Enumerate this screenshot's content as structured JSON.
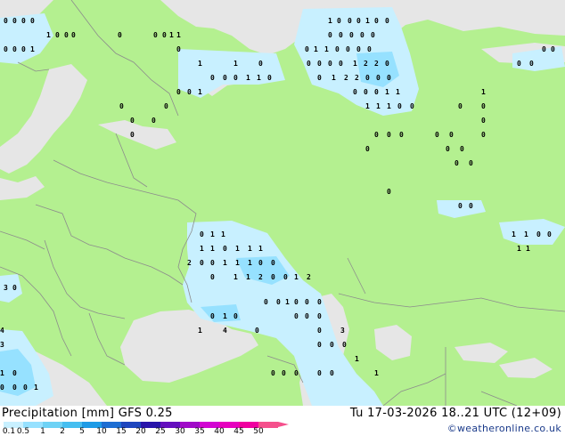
{
  "footer": {
    "title_left": "Precipitation [mm]  GFS 0.25",
    "title_right": "Tu 17-03-2026 18..21 UTC (12+09)",
    "copyright": "©weatheronline.co.uk"
  },
  "legend": {
    "ticks": [
      "0.1",
      "0.5",
      "1",
      "2",
      "5",
      "10",
      "15",
      "20",
      "25",
      "30",
      "35",
      "40",
      "45",
      "50"
    ],
    "colors": [
      "#c8f0ff",
      "#96e1ff",
      "#6ed2f5",
      "#46bef0",
      "#1e9be6",
      "#1e6ed2",
      "#1e46be",
      "#2814aa",
      "#640fbe",
      "#a00ac8",
      "#d205d2",
      "#e600be",
      "#f000a0",
      "#f5508c"
    ]
  },
  "map_colors": {
    "land": "#b4f090",
    "sea": "#e6e6e6",
    "borders": "#8c8c8c",
    "precip_light": "#c8f0ff",
    "precip_medium": "#96e1ff"
  },
  "values": [
    "0",
    "0",
    "0",
    "0",
    "1",
    "0",
    "0",
    "0",
    "0",
    "0",
    "0",
    "1",
    "1",
    "0",
    "0",
    "0",
    "1",
    "1",
    "0",
    "0",
    "0",
    "1",
    "0",
    "0",
    "0",
    "0",
    "0",
    "0",
    "0",
    "0",
    "0",
    "0",
    "1",
    "1",
    "0",
    "0",
    "0",
    "0",
    "0",
    "1",
    "1",
    "0",
    "0",
    "0",
    "0",
    "0",
    "1",
    "2",
    "2",
    "0",
    "0",
    "0",
    "0",
    "0",
    "0",
    "1",
    "1",
    "0",
    "0",
    "1",
    "2",
    "2",
    "0",
    "0",
    "0",
    "0",
    "0",
    "1",
    "0",
    "0",
    "0",
    "1",
    "1",
    "1",
    "1",
    "1",
    "1",
    "0",
    "0",
    "0",
    "0",
    "0",
    "0",
    "0",
    "0",
    "0",
    "0",
    "0",
    "0",
    "0",
    "0",
    "0",
    "0",
    "0",
    "0",
    "0",
    "0",
    "0",
    "0",
    "0",
    "0",
    "1",
    "1",
    "0",
    "0",
    "0",
    "1",
    "1",
    "1",
    "1",
    "1",
    "1",
    "0",
    "1",
    "1",
    "1",
    "2",
    "0",
    "0",
    "1",
    "1",
    "1",
    "0",
    "0",
    "0",
    "1",
    "1",
    "2",
    "0",
    "0",
    "1",
    "2",
    "3",
    "0",
    "0",
    "1",
    "0",
    "0",
    "0",
    "1",
    "0",
    "0",
    "0",
    "0",
    "0",
    "0",
    "0",
    "0",
    "0",
    "0",
    "4",
    "3",
    "1",
    "4",
    "3",
    "1",
    "0",
    "1",
    "1",
    "0",
    "0",
    "0",
    "1",
    "0",
    "0",
    "0",
    "0",
    "0",
    "0"
  ]
}
